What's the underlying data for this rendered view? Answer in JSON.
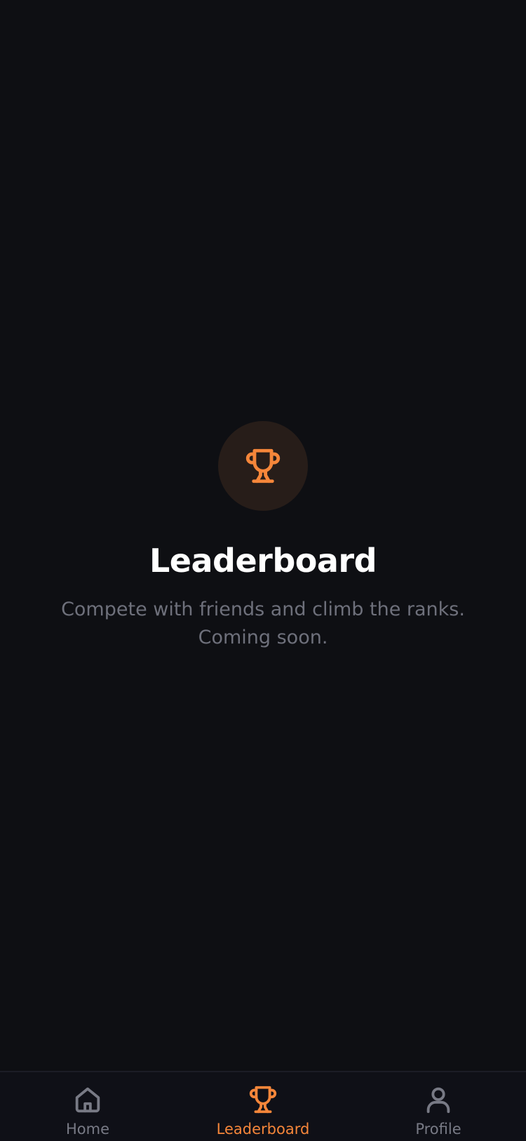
{
  "colors": {
    "background": "#0e0f13",
    "accent": "#f5863a",
    "badge_background": "#271d19",
    "muted_text": "#6e707b",
    "inactive_tab": "#787a85",
    "tabbar_background": "#0f1017"
  },
  "main": {
    "icon": "trophy-icon",
    "title": "Leaderboard",
    "subtitle_line1": "Compete with friends and climb the ranks.",
    "subtitle_line2": "Coming soon."
  },
  "tabbar": {
    "active_tab": "leaderboard",
    "tabs": [
      {
        "id": "home",
        "label": "Home",
        "icon": "home-icon"
      },
      {
        "id": "leaderboard",
        "label": "Leaderboard",
        "icon": "trophy-icon"
      },
      {
        "id": "profile",
        "label": "Profile",
        "icon": "user-icon"
      }
    ]
  }
}
